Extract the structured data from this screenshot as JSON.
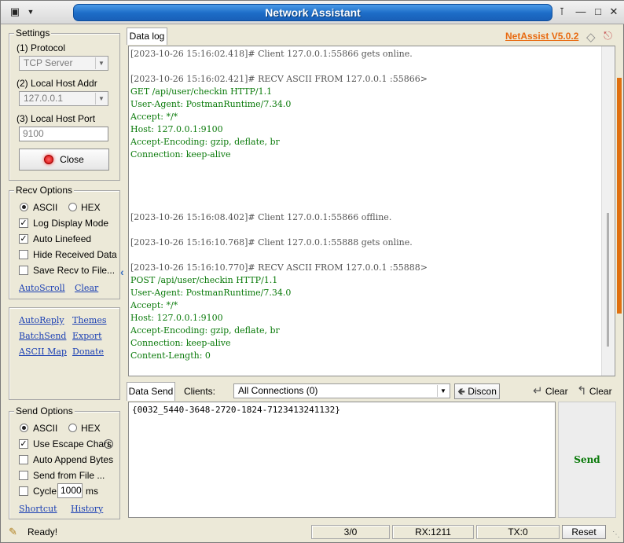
{
  "window": {
    "title": "Network Assistant"
  },
  "header": {
    "brand": "NetAssist V5.0.2",
    "brand_color": "#e86a10"
  },
  "settings": {
    "title": "Settings",
    "protocol_label": "(1) Protocol",
    "protocol_value": "TCP Server",
    "host_addr_label": "(2) Local Host Addr",
    "host_addr_value": "127.0.0.1",
    "host_port_label": "(3) Local Host Port",
    "host_port_value": "9100",
    "close_label": "Close"
  },
  "recv_options": {
    "title": "Recv Options",
    "ascii": "ASCII",
    "hex": "HEX",
    "log_display_mode": "Log Display Mode",
    "auto_linefeed": "Auto Linefeed",
    "hide_received": "Hide Received Data",
    "save_recv": "Save Recv to File...",
    "autoscroll": "AutoScroll",
    "clear": "Clear"
  },
  "links": {
    "autoreply": "AutoReply",
    "themes": "Themes",
    "batchsend": "BatchSend",
    "export": "Export",
    "ascii_map": "ASCII Map",
    "donate": "Donate"
  },
  "send_options": {
    "title": "Send Options",
    "ascii": "ASCII",
    "hex": "HEX",
    "use_escape": "Use Escape Chars",
    "info_icon_char": "i",
    "auto_append": "Auto Append Bytes",
    "send_from_file": "Send from File ...",
    "cycle": "Cycle",
    "cycle_value": "1000",
    "cycle_unit": "ms",
    "shortcut": "Shortcut",
    "history": "History"
  },
  "log": {
    "tab_label": "Data log",
    "lines": [
      {
        "kind": "sys",
        "text": "[2023-10-26 15:16:02.418]# Client 127.0.0.1:55866 gets online."
      },
      {
        "kind": "sys",
        "text": ""
      },
      {
        "kind": "sys",
        "text": "[2023-10-26 15:16:02.421]# RECV ASCII FROM 127.0.0.1 :55866>"
      },
      {
        "kind": "data",
        "text": "GET /api/user/checkin HTTP/1.1"
      },
      {
        "kind": "data",
        "text": "User-Agent: PostmanRuntime/7.34.0"
      },
      {
        "kind": "data",
        "text": "Accept: */*"
      },
      {
        "kind": "data",
        "text": "Host: 127.0.0.1:9100"
      },
      {
        "kind": "data",
        "text": "Accept-Encoding: gzip, deflate, br"
      },
      {
        "kind": "data",
        "text": "Connection: keep-alive"
      },
      {
        "kind": "sys",
        "text": ""
      },
      {
        "kind": "sys",
        "text": ""
      },
      {
        "kind": "sys",
        "text": ""
      },
      {
        "kind": "sys",
        "text": ""
      },
      {
        "kind": "sys",
        "text": "[2023-10-26 15:16:08.402]# Client 127.0.0.1:55866 offline."
      },
      {
        "kind": "sys",
        "text": ""
      },
      {
        "kind": "sys",
        "text": "[2023-10-26 15:16:10.768]# Client 127.0.0.1:55888 gets online."
      },
      {
        "kind": "sys",
        "text": ""
      },
      {
        "kind": "sys",
        "text": "[2023-10-26 15:16:10.770]# RECV ASCII FROM 127.0.0.1 :55888>"
      },
      {
        "kind": "data",
        "text": "POST /api/user/checkin HTTP/1.1"
      },
      {
        "kind": "data",
        "text": "User-Agent: PostmanRuntime/7.34.0"
      },
      {
        "kind": "data",
        "text": "Accept: */*"
      },
      {
        "kind": "data",
        "text": "Host: 127.0.0.1:9100"
      },
      {
        "kind": "data",
        "text": "Accept-Encoding: gzip, deflate, br"
      },
      {
        "kind": "data",
        "text": "Connection: keep-alive"
      },
      {
        "kind": "data",
        "text": "Content-Length: 0"
      }
    ]
  },
  "send": {
    "tab_label": "Data Send",
    "clients_label": "Clients:",
    "clients_value": "All Connections (0)",
    "disconn_label": "Discon",
    "clear1_label": "Clear",
    "clear2_label": "Clear",
    "content": "{0032_5440-3648-2720-1824-7123413241132}",
    "send_label": "Send"
  },
  "status": {
    "ready": "Ready!",
    "counter": "3/0",
    "rx": "RX:1211",
    "tx": "TX:0",
    "reset": "Reset"
  }
}
